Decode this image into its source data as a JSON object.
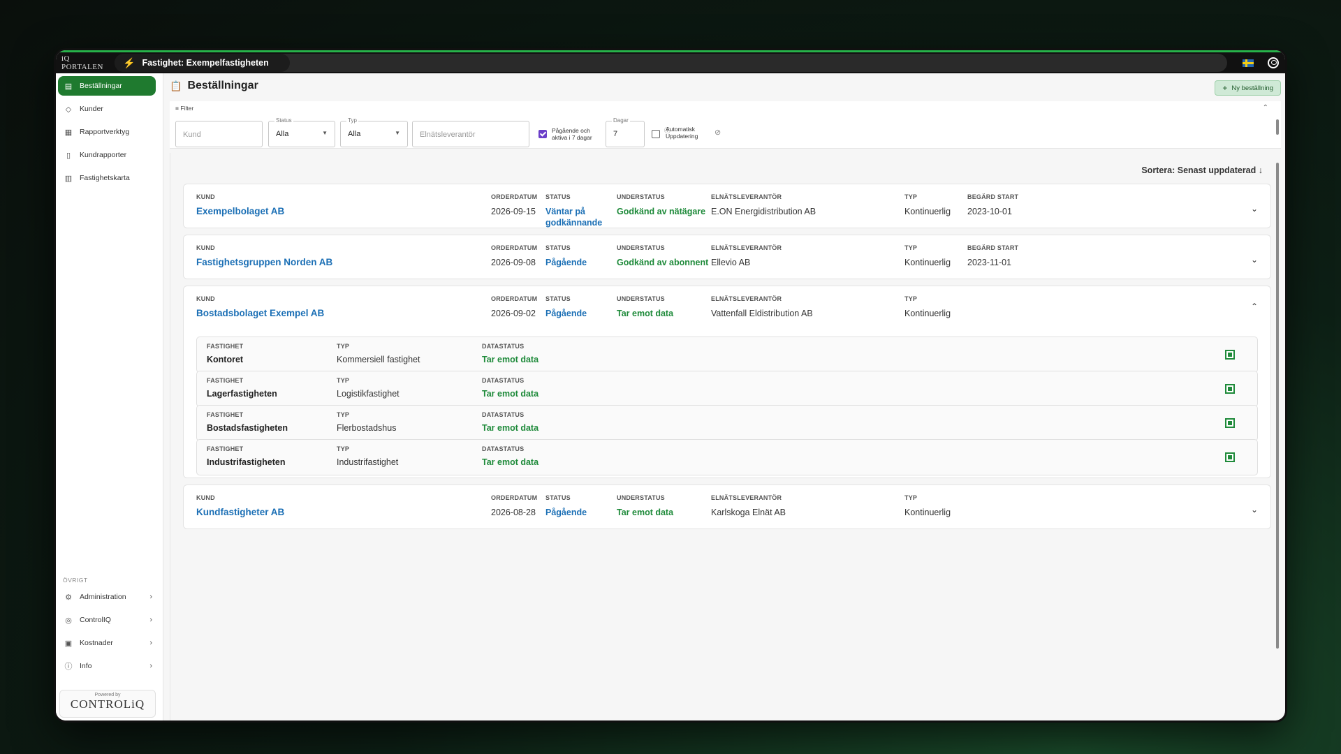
{
  "topbar": {
    "logo": "iQ PORTALEN",
    "property": "Fastighet: Exempelfastigheten"
  },
  "sidebar": {
    "items": [
      {
        "label": "Beställningar",
        "icon": "clipboard-icon",
        "active": true
      },
      {
        "label": "Kunder",
        "icon": "handshake-icon"
      },
      {
        "label": "Rapportverktyg",
        "icon": "report-tool-icon"
      },
      {
        "label": "Kundrapporter",
        "icon": "document-icon"
      },
      {
        "label": "Fastighetskarta",
        "icon": "map-icon"
      }
    ],
    "section_label": "ÖVRIGT",
    "bottom_items": [
      {
        "label": "Administration",
        "icon": "gear-icon"
      },
      {
        "label": "ControlIQ",
        "icon": "control-icon"
      },
      {
        "label": "Kostnader",
        "icon": "money-icon"
      },
      {
        "label": "Info",
        "icon": "info-icon"
      }
    ],
    "powered_by": "Powered by",
    "brand": "CONTROLiQ"
  },
  "page": {
    "title": "Beställningar",
    "new_button": "Ny beställning"
  },
  "filter": {
    "title": "Filter",
    "kund_placeholder": "Kund",
    "status_label": "Status",
    "status_value": "Alla",
    "typ_label": "Typ",
    "typ_value": "Alla",
    "elnat_placeholder": "Elnätsleverantör",
    "ongoing_line1": "Pågående och",
    "ongoing_line2": "aktiva i 7 dagar",
    "ongoing_checked": true,
    "dagar_label": "Dagar",
    "dagar_value": "7",
    "auto_line1": "Automatisk",
    "auto_line2": "Uppdatering",
    "auto_checked": false
  },
  "sort_label": "Sortera: Senast uppdaterad ↓",
  "headers": {
    "kund": "KUND",
    "orderdatum": "ORDERDATUM",
    "status": "STATUS",
    "understatus": "UNDERSTATUS",
    "elnat": "ELNÄTSLEVERANTÖR",
    "typ": "TYP",
    "start": "BEGÄRD START",
    "fastighet": "FASTIGHET",
    "datastatus": "DATASTATUS"
  },
  "orders": [
    {
      "kund": "Exempelbolaget AB",
      "orderdatum": "2026-09-15",
      "status": "Väntar på godkännande",
      "understatus": "Godkänd av nätägare",
      "elnat": "E.ON Energidistribution AB",
      "typ": "Kontinuerlig",
      "start": "2023-10-01",
      "expanded": false
    },
    {
      "kund": "Fastighetsgruppen Norden AB",
      "orderdatum": "2026-09-08",
      "status": "Pågående",
      "understatus": "Godkänd av abonnent",
      "elnat": "Ellevio AB",
      "typ": "Kontinuerlig",
      "start": "2023-11-01",
      "expanded": false
    },
    {
      "kund": "Bostadsbolaget Exempel AB",
      "orderdatum": "2026-09-02",
      "status": "Pågående",
      "understatus": "Tar emot data",
      "elnat": "Vattenfall Eldistribution AB",
      "typ": "Kontinuerlig",
      "expanded": true,
      "properties": [
        {
          "fastighet": "Kontoret",
          "typ": "Kommersiell fastighet",
          "datastatus": "Tar emot data"
        },
        {
          "fastighet": "Lagerfastigheten",
          "typ": "Logistikfastighet",
          "datastatus": "Tar emot data"
        },
        {
          "fastighet": "Bostadsfastigheten",
          "typ": "Flerbostadshus",
          "datastatus": "Tar emot data"
        },
        {
          "fastighet": "Industrifastigheten",
          "typ": "Industrifastighet",
          "datastatus": "Tar emot data"
        }
      ]
    },
    {
      "kund": "Kundfastigheter AB",
      "orderdatum": "2026-08-28",
      "status": "Pågående",
      "understatus": "Tar emot data",
      "elnat": "Karlskoga Elnät AB",
      "typ": "Kontinuerlig",
      "expanded": false
    }
  ],
  "colors": {
    "accent": "#1f7a2f",
    "link": "#1b6fb5",
    "ok": "#1e8a3a",
    "checkbox": "#6b3fc9"
  }
}
